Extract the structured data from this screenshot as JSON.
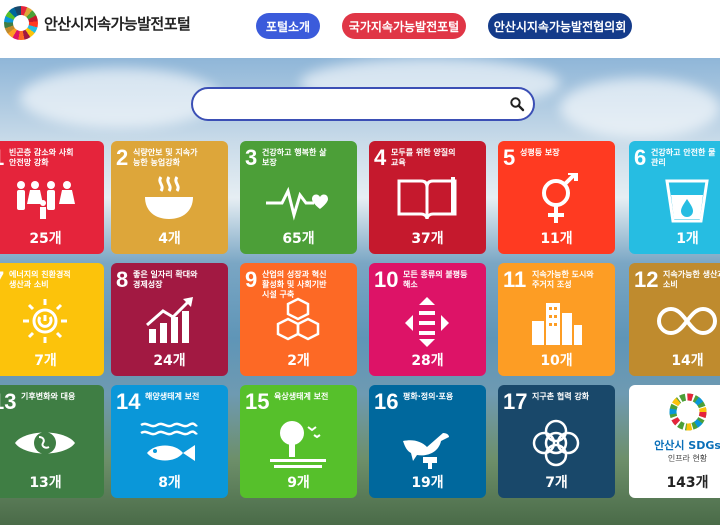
{
  "header": {
    "logo_text": "안산시지속가능발전포털",
    "nav": [
      {
        "label": "포털소개",
        "color": "#3b5bdb"
      },
      {
        "label": "국가지속가능발전포털",
        "color": "#e03646"
      },
      {
        "label": "안산시지속가능발전협의회",
        "color": "#143b8a"
      }
    ]
  },
  "search": {
    "placeholder": "",
    "value": ""
  },
  "goals": [
    {
      "num": "1",
      "title": "빈곤층 감소와 사회안전망 강화",
      "count": "25개",
      "color": "#e5243b",
      "icon": "people-icon"
    },
    {
      "num": "2",
      "title": "식량안보 및 지속가능한 농업강화",
      "count": "4개",
      "color": "#dda63a",
      "icon": "food-bowl-icon"
    },
    {
      "num": "3",
      "title": "건강하고 행복한 삶 보장",
      "count": "65개",
      "color": "#4c9f38",
      "icon": "heartbeat-icon"
    },
    {
      "num": "4",
      "title": "모두를 위한 양질의 교육",
      "count": "37개",
      "color": "#c5192d",
      "icon": "book-icon"
    },
    {
      "num": "5",
      "title": "성평등 보장",
      "count": "11개",
      "color": "#ff3a21",
      "icon": "gender-icon"
    },
    {
      "num": "6",
      "title": "건강하고 안전한 물관리",
      "count": "1개",
      "color": "#26bde2",
      "icon": "water-icon"
    },
    {
      "num": "7",
      "title": "에너지의 친환경적 생산과 소비",
      "count": "7개",
      "color": "#fcc30b",
      "icon": "sun-power-icon"
    },
    {
      "num": "8",
      "title": "좋은 일자리 확대와 경제성장",
      "count": "24개",
      "color": "#a21942",
      "icon": "growth-chart-icon"
    },
    {
      "num": "9",
      "title": "산업의 성장과 혁신 활성화 및 사회기반시설 구축",
      "count": "2개",
      "color": "#fd6925",
      "icon": "cubes-icon"
    },
    {
      "num": "10",
      "title": "모든 종류의 불평등 해소",
      "count": "28개",
      "color": "#dd1367",
      "icon": "equality-icon"
    },
    {
      "num": "11",
      "title": "지속가능한 도시와 주거지 조성",
      "count": "10개",
      "color": "#fd9d24",
      "icon": "city-icon"
    },
    {
      "num": "12",
      "title": "지속가능한 생산과 소비",
      "count": "14개",
      "color": "#bf8b2e",
      "icon": "infinity-icon"
    },
    {
      "num": "13",
      "title": "기후변화와 대응",
      "count": "13개",
      "color": "#3f7e44",
      "icon": "eye-globe-icon"
    },
    {
      "num": "14",
      "title": "해양생태계 보전",
      "count": "8개",
      "color": "#0a97d9",
      "icon": "fish-icon"
    },
    {
      "num": "15",
      "title": "육상생태계 보전",
      "count": "9개",
      "color": "#56c02b",
      "icon": "tree-icon"
    },
    {
      "num": "16",
      "title": "평화·정의·포용",
      "count": "19개",
      "color": "#00689d",
      "icon": "dove-icon"
    },
    {
      "num": "17",
      "title": "지구촌 협력 강화",
      "count": "7개",
      "color": "#19486a",
      "icon": "rings-icon"
    }
  ],
  "infra": {
    "title": "안산시 SDGs",
    "subtitle": "인프라 현황",
    "count": "143개"
  }
}
